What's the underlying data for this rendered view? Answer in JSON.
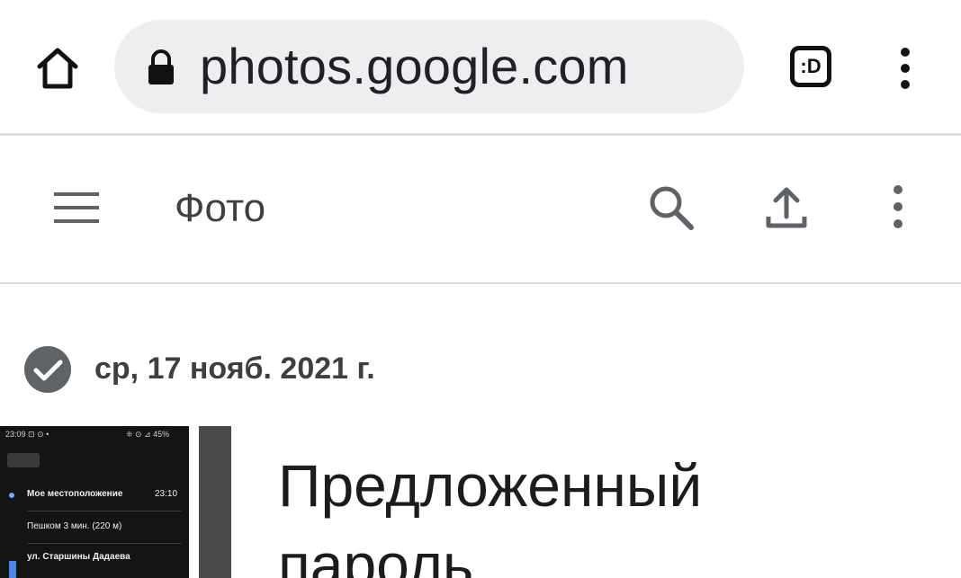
{
  "browser": {
    "url": "photos.google.com",
    "tab_button_label": ":D",
    "icons": [
      "home-icon",
      "lock-icon",
      "tab-switcher-icon",
      "more-vert-icon"
    ]
  },
  "toolbar": {
    "title": "Фото",
    "icons": [
      "menu-icon",
      "search-icon",
      "upload-icon",
      "more-vert-icon"
    ]
  },
  "date_group": {
    "date_label": "ср, 17 нояб. 2021 г.",
    "icon": "check-circle-icon"
  },
  "thumbnails": [
    {
      "status_left": "23:09 ⊡ ⊙ •",
      "status_right": "⁜ ⊙ ⊿ 45%",
      "rows": [
        {
          "text": "Мое местоположение",
          "time": "23:10"
        },
        {
          "text": "Пешком 3 мин. (220 м)"
        },
        {
          "text": "ул. Старшины Дадаева"
        }
      ]
    },
    {
      "lines": [
        "Предложенный",
        "пароль"
      ]
    }
  ],
  "colors": {
    "url_pill": "#eceef0",
    "icon_dark": "#111111",
    "icon_gray": "#5f6368",
    "text": "#3c4043",
    "check_circle": "#5f6368"
  }
}
